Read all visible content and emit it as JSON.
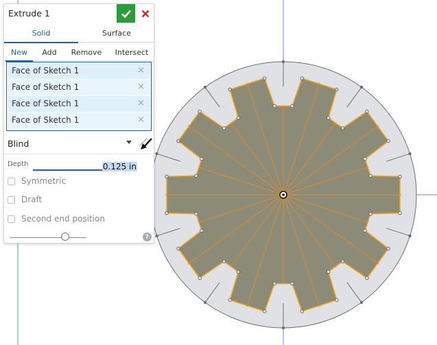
{
  "panel": {
    "title": "Extrude 1",
    "tabs": [
      {
        "label": "Solid",
        "active": true
      },
      {
        "label": "Surface",
        "active": false
      }
    ],
    "operations": [
      {
        "label": "New",
        "active": true
      },
      {
        "label": "Add",
        "active": false
      },
      {
        "label": "Remove",
        "active": false
      },
      {
        "label": "Intersect",
        "active": false
      }
    ],
    "selections": [
      {
        "label": "Face of Sketch 1"
      },
      {
        "label": "Face of Sketch 1"
      },
      {
        "label": "Face of Sketch 1"
      },
      {
        "label": "Face of Sketch 1"
      }
    ],
    "remove_glyph": "×",
    "end_type": "Blind",
    "depth_label": "Depth",
    "depth_value": "0.125 in",
    "symmetric_label": "Symmetric",
    "draft_label": "Draft",
    "second_end_label": "Second end position",
    "help_glyph": "?",
    "slider_level": 0.72,
    "icons": {
      "confirm": "check-icon",
      "cancel": "close-icon",
      "dropdown": "chevron-down-icon",
      "flip": "flip-direction-icon",
      "help": "help-icon"
    }
  },
  "colors": {
    "accent": "#1e5fa8",
    "confirm": "#2e9b3a",
    "cancel": "#d0282e",
    "face_fill": "#8b8b78",
    "face_edge": "#f2a019",
    "disc_fill": "#dfe1e5",
    "sketch_lines": "#e08a2a",
    "axes": "#5a8fcf"
  }
}
